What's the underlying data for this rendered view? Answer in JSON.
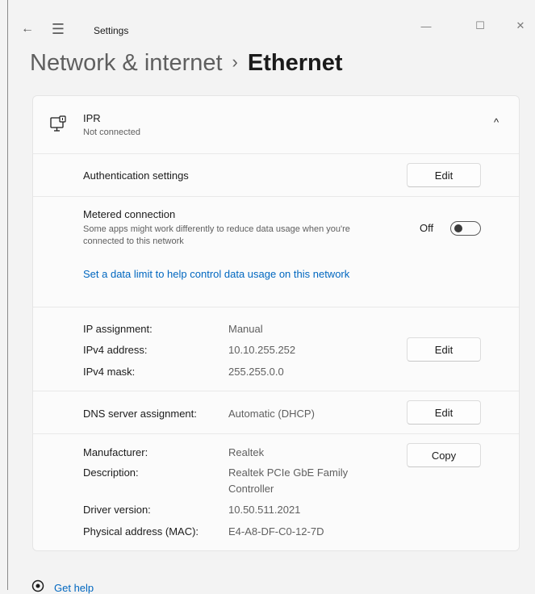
{
  "window": {
    "title": "Settings",
    "back_icon": "←",
    "menu_icon": "☰",
    "minimize_icon": "—",
    "maximize_icon": "☐",
    "close_icon": "✕"
  },
  "header": {
    "parent": "Network & internet",
    "separator": "›",
    "current": "Ethernet"
  },
  "adapter": {
    "name": "IPR",
    "status": "Not connected",
    "collapse_icon": "^"
  },
  "authentication": {
    "label": "Authentication settings",
    "button": "Edit"
  },
  "metered": {
    "title": "Metered connection",
    "description_line1": "Some apps might work differently to reduce data usage when you're",
    "description_line2": "connected to this network",
    "state": "Off",
    "data_limit_link": "Set a data limit to help control data usage on this network"
  },
  "ip": {
    "assignment_label": "IP assignment:",
    "assignment_value": "Manual",
    "ipv4_label": "IPv4 address:",
    "ipv4_value": "10.10.255.252",
    "mask_label": "IPv4 mask:",
    "mask_value": "255.255.0.0",
    "button": "Edit"
  },
  "dns": {
    "label": "DNS server assignment:",
    "value": "Automatic (DHCP)",
    "button": "Edit"
  },
  "details": {
    "manufacturer_label": "Manufacturer:",
    "manufacturer_value": "Realtek",
    "description_label": "Description:",
    "description_value_line1": "Realtek PCIe GbE Family",
    "description_value_line2": "Controller",
    "driver_label": "Driver version:",
    "driver_value": "10.50.511.2021",
    "mac_label": "Physical address (MAC):",
    "mac_value": "E4-A8-DF-C0-12-7D",
    "button": "Copy"
  },
  "footer": {
    "help_link": "Get help"
  },
  "colors": {
    "accent": "#0067c0",
    "background": "#f3f3f3",
    "card": "#fbfbfb"
  }
}
